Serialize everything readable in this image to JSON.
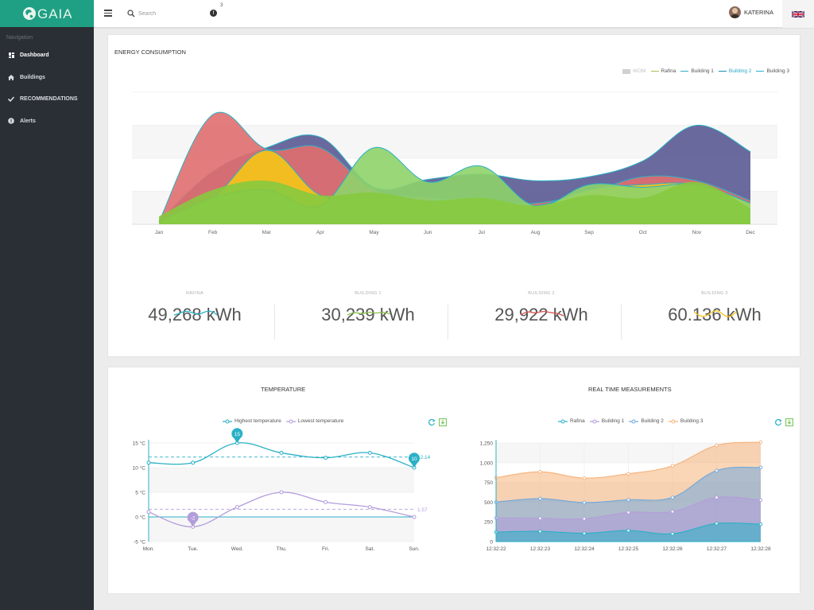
{
  "app": {
    "logo_text": "GAIA",
    "brand_color": "#1fa085",
    "sidebar_color": "#2a2f35"
  },
  "sidebar": {
    "heading": "Navigation",
    "items": [
      {
        "label": "Dashboard",
        "icon": "dashboard-icon"
      },
      {
        "label": "Buildings",
        "icon": "home-icon"
      },
      {
        "label": "RECOMMENDATIONS",
        "icon": "check-icon"
      },
      {
        "label": "Alerts",
        "icon": "alert-circle-icon"
      }
    ]
  },
  "topbar": {
    "menu_icon": "hamburger-icon",
    "search_placeholder": "Search",
    "notification_icon": "exclamation-icon",
    "notification_count": "3",
    "user_name": "KATERINA",
    "language_icon": "uk-flag-icon"
  },
  "energy": {
    "title": "ENERGY CONSUMPTION",
    "legend": [
      {
        "name": "WOM",
        "color": "#d0d0d0",
        "state": "hidden"
      },
      {
        "name": "Rafina",
        "color": "#a7c256",
        "state": "normal"
      },
      {
        "name": "Building 1",
        "color": "#2ab1c6",
        "state": "normal"
      },
      {
        "name": "Building 2",
        "color": "#1a8fb0",
        "state": "selected"
      },
      {
        "name": "Building 3",
        "color": "#2ab1c6",
        "state": "normal"
      }
    ],
    "stats": [
      {
        "label": "RAFINA",
        "value": "49,268 kWh",
        "spark_color": "#2ab1c6"
      },
      {
        "label": "BUILDING 1",
        "value": "30,239 kWh",
        "spark_color": "#8bc34a"
      },
      {
        "label": "BUILDING 2",
        "value": "29,922 kWh",
        "spark_color": "#d9534f"
      },
      {
        "label": "BUILDING 3",
        "value": "60.136 kWh",
        "spark_color": "#f5c518"
      }
    ]
  },
  "temperature": {
    "title": "TEMPERATURE",
    "legend": [
      {
        "name": "Highest temperature",
        "color": "#2ab1c6"
      },
      {
        "name": "Lowest temperature",
        "color": "#b39ddb"
      }
    ],
    "tool_icons": [
      "refresh-icon",
      "save-image-icon"
    ]
  },
  "realtime": {
    "title": "REAL TIME MEASUREMENTS",
    "legend": [
      {
        "name": "Rafina",
        "color": "#2ab1c6"
      },
      {
        "name": "Building 1",
        "color": "#b39ddb"
      },
      {
        "name": "Building 2",
        "color": "#6fa8dc"
      },
      {
        "name": "Building 3",
        "color": "#f6b27a"
      }
    ],
    "tool_icons": [
      "refresh-icon",
      "save-image-icon"
    ]
  },
  "chart_data": [
    {
      "type": "area",
      "title": "ENERGY CONSUMPTION",
      "categories": [
        "Jan",
        "Feb",
        "Mar",
        "Apr",
        "May",
        "Jun",
        "Jul",
        "Aug",
        "Sep",
        "Oct",
        "Nov",
        "Dec"
      ],
      "ylim": [
        0,
        100
      ],
      "grid": true,
      "legend_position": "top-right",
      "series": [
        {
          "name": "Building 3",
          "color": "#5b5a93",
          "values": [
            2,
            40,
            58,
            66,
            28,
            34,
            38,
            33,
            36,
            48,
            75,
            55
          ]
        },
        {
          "name": "Building 2",
          "color": "#e06f6f",
          "values": [
            2,
            83,
            57,
            58,
            26,
            20,
            18,
            16,
            24,
            36,
            33,
            18
          ]
        },
        {
          "name": "Building 1",
          "color": "#f5c518",
          "values": [
            2,
            20,
            56,
            22,
            20,
            18,
            20,
            14,
            26,
            30,
            30,
            16
          ]
        },
        {
          "name": "Rafina",
          "color": "#8ed36a",
          "values": [
            2,
            20,
            26,
            14,
            58,
            32,
            44,
            14,
            30,
            28,
            30,
            16
          ]
        },
        {
          "name": "WOM",
          "color": "#86c93f",
          "values": [
            6,
            26,
            33,
            22,
            24,
            18,
            20,
            14,
            22,
            20,
            32,
            12
          ]
        }
      ]
    },
    {
      "type": "line",
      "title": "TEMPERATURE",
      "categories": [
        "Mon.",
        "Tue.",
        "Wed.",
        "Thu.",
        "Fri.",
        "Sat.",
        "Sun."
      ],
      "ylim": [
        -5,
        15
      ],
      "yticks": [
        "15 °C",
        "10 °C",
        "5 °C",
        "0 °C",
        "-5 °C"
      ],
      "legend_position": "top",
      "series": [
        {
          "name": "Highest temperature",
          "color": "#2ab1c6",
          "values": [
            11,
            11,
            15,
            13,
            12,
            13,
            10
          ],
          "max_label": "15",
          "min_label": "10",
          "average": 12.14,
          "average_label": "12.14"
        },
        {
          "name": "Lowest temperature",
          "color": "#b39ddb",
          "values": [
            1,
            -2,
            2,
            5,
            3,
            2,
            0
          ],
          "min_label": "-2",
          "average": 1.57,
          "average_label": "1.57"
        }
      ]
    },
    {
      "type": "area",
      "title": "REAL TIME MEASUREMENTS",
      "categories": [
        "12:32:22",
        "12:32:23",
        "12:32:24",
        "12:32:25",
        "12:32:26",
        "12:32:27",
        "12:32:28"
      ],
      "ylim": [
        0,
        1250
      ],
      "yticks": [
        "1,250",
        "1,000",
        "750",
        "500",
        "250",
        "0"
      ],
      "stacked": true,
      "legend_position": "top",
      "series": [
        {
          "name": "Rafina",
          "color": "#2ab1c6",
          "values": [
            120,
            130,
            105,
            140,
            100,
            230,
            220
          ]
        },
        {
          "name": "Building 1",
          "color": "#b39ddb",
          "values": [
            180,
            165,
            185,
            230,
            280,
            330,
            305
          ]
        },
        {
          "name": "Building 2",
          "color": "#6fa8dc",
          "values": [
            200,
            250,
            205,
            160,
            180,
            340,
            415
          ]
        },
        {
          "name": "Building 3",
          "color": "#f6b27a",
          "values": [
            310,
            340,
            310,
            330,
            400,
            320,
            320
          ]
        }
      ]
    }
  ]
}
